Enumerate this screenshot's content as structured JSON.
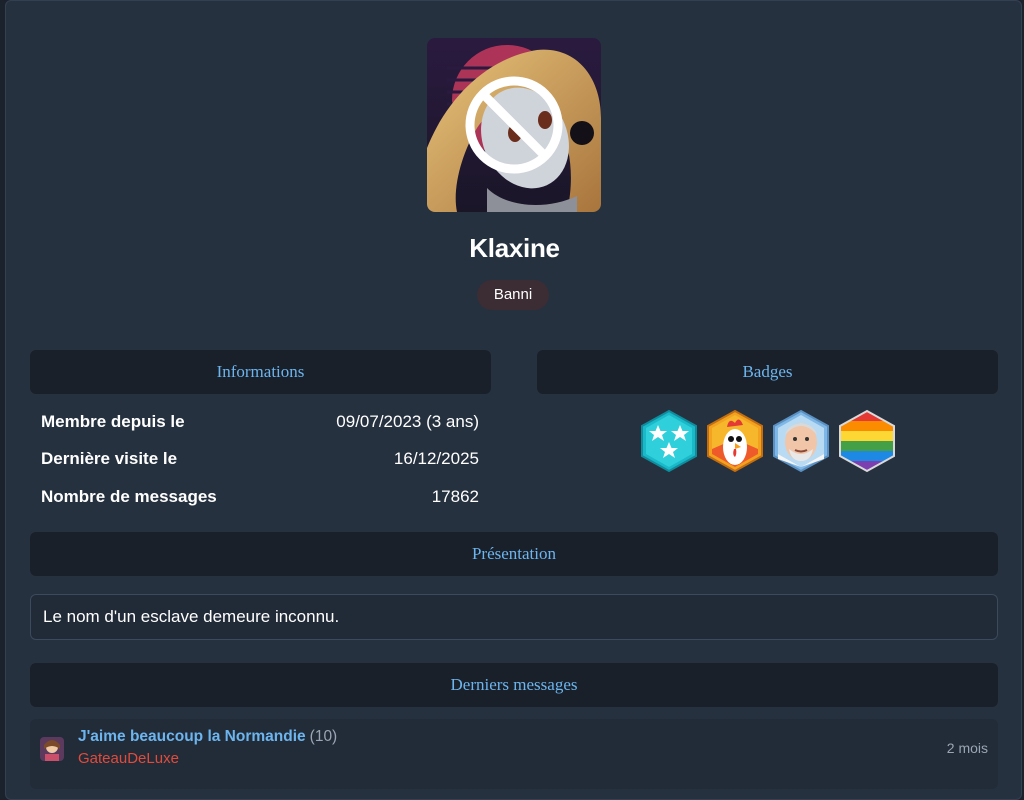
{
  "profile": {
    "username": "Klaxine",
    "role": "Banni",
    "avatar_icon": "banned-avatar-icon"
  },
  "informations": {
    "title": "Informations",
    "rows": [
      {
        "label": "Membre depuis le",
        "value": "09/07/2023 (3 ans)"
      },
      {
        "label": "Dernière visite le",
        "value": "16/12/2025"
      },
      {
        "label": "Nombre de messages",
        "value": "17862"
      }
    ]
  },
  "badges": {
    "title": "Badges",
    "items": [
      {
        "icon": "stars-badge-icon"
      },
      {
        "icon": "rooster-badge-icon"
      },
      {
        "icon": "harold-face-badge-icon"
      },
      {
        "icon": "rainbow-flag-badge-icon"
      }
    ]
  },
  "presentation": {
    "title": "Présentation",
    "text": "Le nom d'un esclave demeure inconnu."
  },
  "latest_messages": {
    "title": "Derniers messages",
    "items": [
      {
        "title": "J'aime beaucoup la Normandie",
        "count": "(10)",
        "author": "GateauDeLuxe",
        "time": "2 mois"
      }
    ]
  },
  "colors": {
    "accent": "#6cb5ee",
    "card": "#263140",
    "header": "#19202a",
    "author": "#e24b3b"
  }
}
